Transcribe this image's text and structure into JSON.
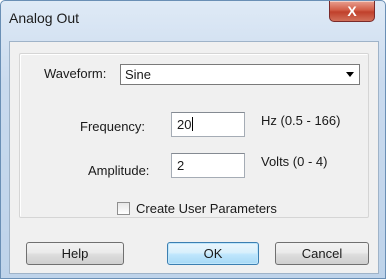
{
  "window": {
    "title": "Analog Out",
    "close_label": "X"
  },
  "form": {
    "waveform_label": "Waveform:",
    "waveform_value": "Sine",
    "frequency_label": "Frequency:",
    "frequency_value": "20",
    "frequency_range": "Hz (0.5 - 166)",
    "amplitude_label": "Amplitude:",
    "amplitude_value": "2",
    "amplitude_range": "Volts (0 - 4)",
    "user_params_label": "Create User Parameters",
    "user_params_checked": false
  },
  "buttons": {
    "help": "Help",
    "ok": "OK",
    "cancel": "Cancel"
  },
  "icons": {
    "close": "close-icon",
    "dropdown": "chevron-down-icon"
  }
}
